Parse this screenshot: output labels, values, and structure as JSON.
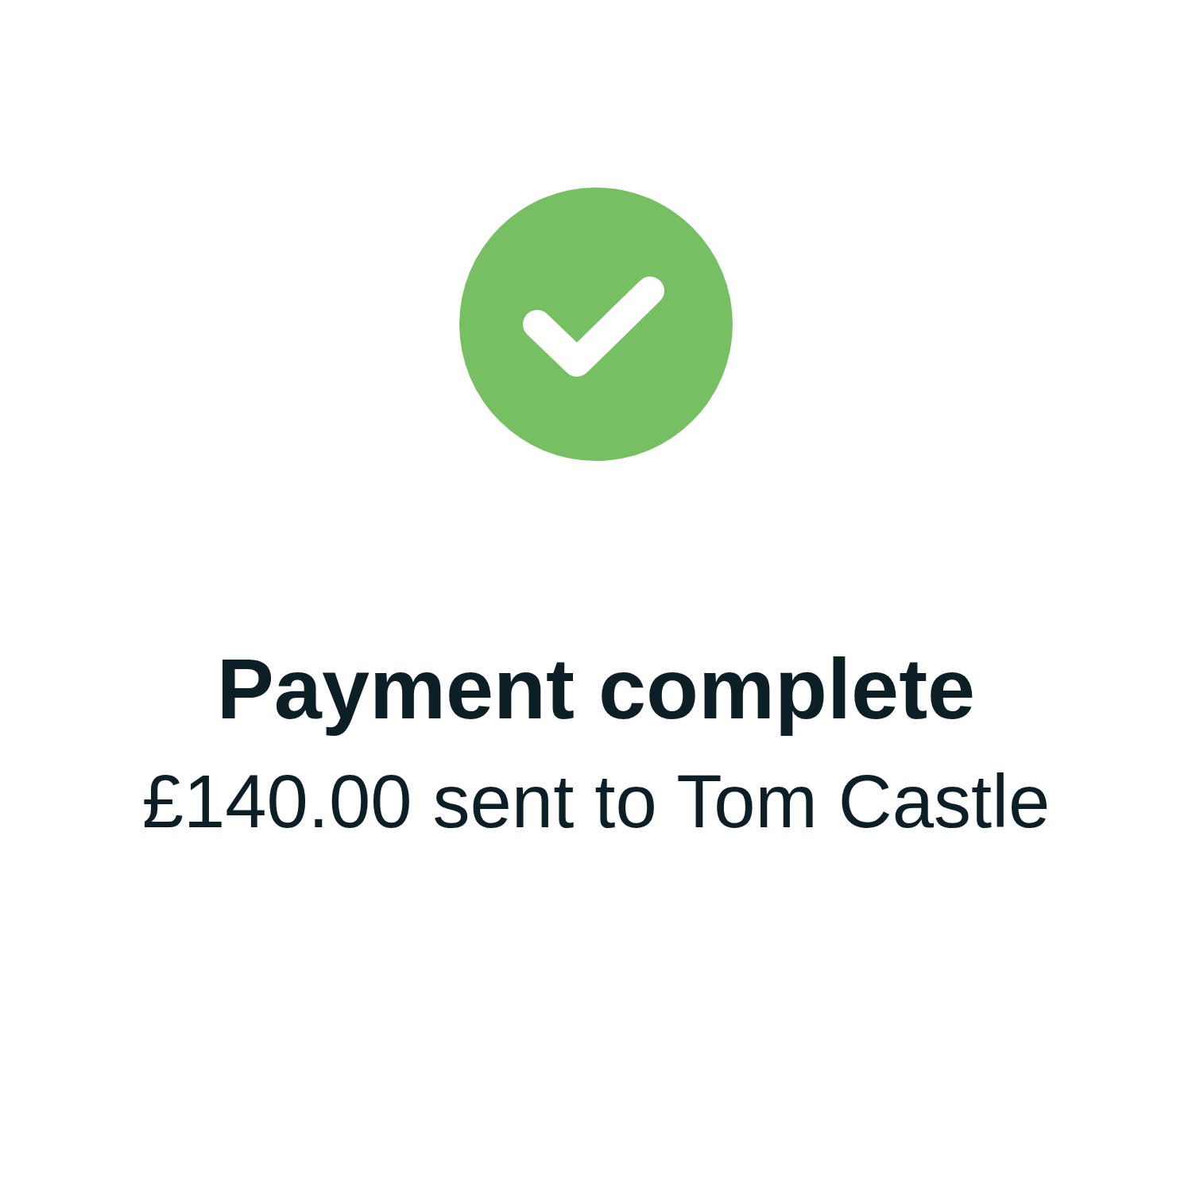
{
  "title": "Payment complete",
  "message": "£140.00 sent to Tom Castle"
}
